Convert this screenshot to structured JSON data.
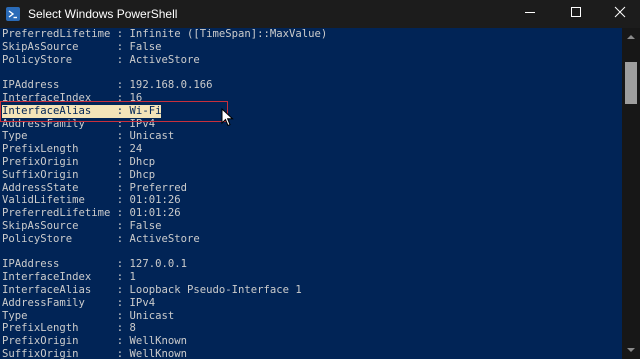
{
  "window": {
    "title": "Select Windows PowerShell",
    "background_color": "#012456",
    "text_color": "#cccccc",
    "selection_color": "#f4e4b8",
    "highlight_border_color": "#c8303c"
  },
  "console": {
    "lines": [
      "PreferredLifetime : Infinite ([TimeSpan]::MaxValue)",
      "SkipAsSource      : False",
      "PolicyStore       : ActiveStore",
      "",
      "IPAddress         : 192.168.0.166",
      "InterfaceIndex    : 16",
      "InterfaceAlias    : Wi-Fi",
      "AddressFamily     : IPv4",
      "Type              : Unicast",
      "PrefixLength      : 24",
      "PrefixOrigin      : Dhcp",
      "SuffixOrigin      : Dhcp",
      "AddressState      : Preferred",
      "ValidLifetime     : 01:01:26",
      "PreferredLifetime : 01:01:26",
      "SkipAsSource      : False",
      "PolicyStore       : ActiveStore",
      "",
      "IPAddress         : 127.0.0.1",
      "InterfaceIndex    : 1",
      "InterfaceAlias    : Loopback Pseudo-Interface 1",
      "AddressFamily     : IPv4",
      "Type              : Unicast",
      "PrefixLength      : 8",
      "PrefixOrigin      : WellKnown",
      "SuffixOrigin      : WellKnown"
    ],
    "selected_line_index": 6
  },
  "icons": {
    "app": "powershell-icon",
    "minimize": "minimize-icon",
    "maximize": "maximize-icon",
    "close": "close-icon",
    "scroll_up": "scroll-up-arrow-icon",
    "scroll_down": "scroll-down-arrow-icon",
    "cursor": "mouse-cursor-icon"
  }
}
